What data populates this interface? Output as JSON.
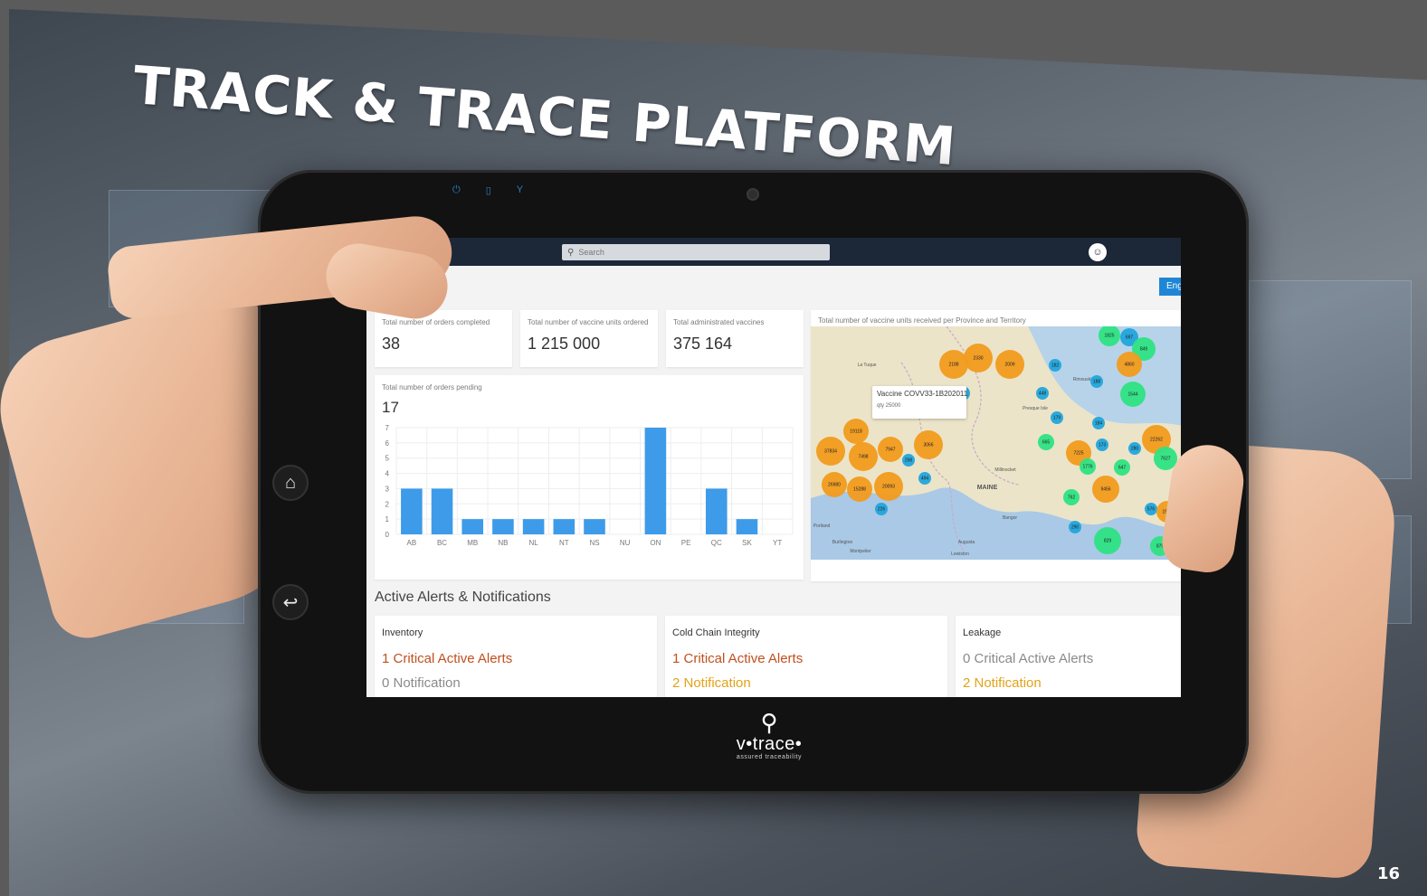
{
  "slide": {
    "title": "TRACK & TRACE PLATFORM",
    "page_number": "16"
  },
  "tablet": {
    "top_sensor_icons": [
      "power-icon",
      "sim-icon",
      "signal-icon"
    ],
    "side_buttons": [
      "home-icon",
      "back-icon"
    ],
    "logo": {
      "name": "v•trace•",
      "tagline": "assured traceability"
    }
  },
  "app": {
    "search": {
      "placeholder": "Search"
    },
    "language_button": "Engl",
    "stats": [
      {
        "label": "Total number of orders completed",
        "value": "38"
      },
      {
        "label": "Total number of vaccine units ordered",
        "value": "1 215 000"
      },
      {
        "label": "Total administrated vaccines",
        "value": "375 164"
      }
    ],
    "pending": {
      "label": "Total number of orders pending",
      "value": "17"
    },
    "map": {
      "title": "Total number of vaccine units received per Province and Territory",
      "popup": {
        "title": "Vaccine COVV33-1B202011",
        "qty": "qty 25000"
      },
      "place_labels": [
        "MAINE",
        "Presque Isle",
        "Bangor",
        "Augusta",
        "Lewiston",
        "Burlington",
        "Montpelier",
        "Millinocket",
        "Portland",
        "La Tuque",
        "Rimouski"
      ]
    },
    "alerts": {
      "heading": "Active Alerts & Notifications",
      "cards": [
        {
          "title": "Inventory",
          "critical": "1 Critical Active Alerts",
          "notification": "0 Notification",
          "critical_color": "#c0501f",
          "notification_color": "#8a8a8a"
        },
        {
          "title": "Cold Chain Integrity",
          "critical": "1 Critical Active Alerts",
          "notification": "2 Notification",
          "critical_color": "#c0501f",
          "notification_color": "#e3a21a"
        },
        {
          "title": "Leakage",
          "critical": "0 Critical Active Alerts",
          "notification": "2 Notification",
          "critical_color": "#8a8a8a",
          "notification_color": "#e3a21a"
        }
      ]
    }
  },
  "chart_data": {
    "type": "bar",
    "categories": [
      "AB",
      "BC",
      "MB",
      "NB",
      "NL",
      "NT",
      "NS",
      "NU",
      "ON",
      "PE",
      "QC",
      "SK",
      "YT"
    ],
    "values": [
      3,
      3,
      1,
      1,
      1,
      1,
      1,
      0,
      7,
      0,
      3,
      1,
      0
    ],
    "ylim": [
      0,
      7
    ],
    "yticks": [
      0,
      1,
      2,
      3,
      4,
      5,
      6,
      7
    ],
    "bar_color": "#3d9be9",
    "grid": true
  },
  "map_clusters": [
    {
      "value": "2188",
      "color": "orange"
    },
    {
      "value": "2330",
      "color": "orange"
    },
    {
      "value": "2009",
      "color": "orange"
    },
    {
      "value": "1825",
      "color": "green"
    },
    {
      "value": "697",
      "color": "blue"
    },
    {
      "value": "849",
      "color": "green"
    },
    {
      "value": "4860",
      "color": "orange"
    },
    {
      "value": "1544",
      "color": "green"
    },
    {
      "value": "182",
      "color": "blue"
    },
    {
      "value": "188",
      "color": "blue"
    },
    {
      "value": "448",
      "color": "blue"
    },
    {
      "value": "179",
      "color": "blue"
    },
    {
      "value": "184",
      "color": "blue"
    },
    {
      "value": "173",
      "color": "blue"
    },
    {
      "value": "22262",
      "color": "orange"
    },
    {
      "value": "665",
      "color": "green"
    },
    {
      "value": "7225",
      "color": "orange"
    },
    {
      "value": "1776",
      "color": "green"
    },
    {
      "value": "647",
      "color": "green"
    },
    {
      "value": "7627",
      "color": "green"
    },
    {
      "value": "280",
      "color": "blue"
    },
    {
      "value": "9456",
      "color": "orange"
    },
    {
      "value": "762",
      "color": "green"
    },
    {
      "value": "576",
      "color": "blue"
    },
    {
      "value": "829",
      "color": "green"
    },
    {
      "value": "290",
      "color": "blue"
    },
    {
      "value": "1979",
      "color": "orange"
    },
    {
      "value": "879",
      "color": "green"
    },
    {
      "value": "19118",
      "color": "orange"
    },
    {
      "value": "7947",
      "color": "orange"
    },
    {
      "value": "3066",
      "color": "orange"
    },
    {
      "value": "37834",
      "color": "orange"
    },
    {
      "value": "7498",
      "color": "orange"
    },
    {
      "value": "298",
      "color": "blue"
    },
    {
      "value": "26980",
      "color": "orange"
    },
    {
      "value": "15288",
      "color": "orange"
    },
    {
      "value": "20093",
      "color": "orange"
    },
    {
      "value": "494",
      "color": "blue"
    },
    {
      "value": "226",
      "color": "blue"
    },
    {
      "value": "768",
      "color": "blue"
    }
  ]
}
